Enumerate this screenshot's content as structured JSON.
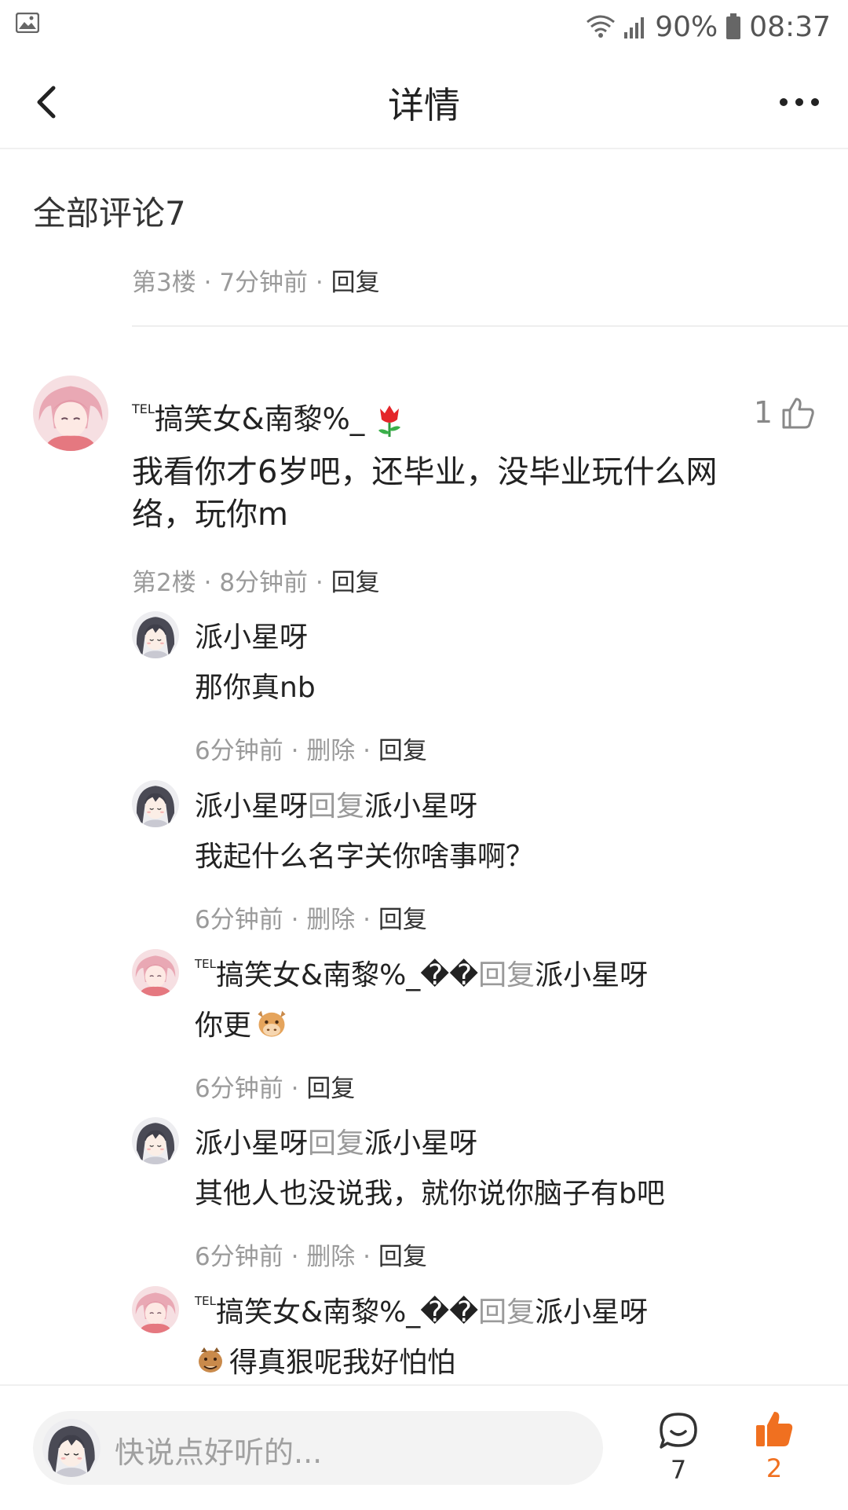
{
  "status_bar": {
    "battery": "90%",
    "time": "08:37"
  },
  "nav": {
    "title": "详情"
  },
  "comments_header": "全部评论7",
  "floor3_meta": {
    "floor": "第3楼",
    "time": "7分钟前",
    "reply": "回复",
    "sep": "·"
  },
  "main_comment": {
    "tel": "TEL",
    "user": "搞笑女&南黎%_",
    "likes": "1",
    "text": "我看你才6岁吧，还毕业，没毕业玩什么网络，玩你m",
    "floor": "第2楼",
    "time": "8分钟前",
    "reply": "回复"
  },
  "replies": [
    {
      "name": "派小星呀",
      "text": "那你真nb",
      "time": "6分钟前",
      "delete": "删除",
      "reply": "回复"
    },
    {
      "name": "派小星呀",
      "reply_kw": "回复",
      "target": "派小星呀",
      "text": "我起什么名字关你啥事啊？",
      "time": "6分钟前",
      "delete": "删除",
      "reply": "回复"
    },
    {
      "tel": "TEL",
      "name": "搞笑女&南黎%_��",
      "reply_kw": "回复",
      "target": "派小星呀",
      "text": "你更",
      "time": "6分钟前",
      "reply": "回复"
    },
    {
      "name": "派小星呀",
      "reply_kw": "回复",
      "target": "派小星呀",
      "text": "其他人也没说我，就你说你脑子有b吧",
      "time": "6分钟前",
      "delete": "删除",
      "reply": "回复"
    },
    {
      "tel": "TEL",
      "name": "搞笑女&南黎%_��",
      "reply_kw": "回复",
      "target": "派小星呀",
      "text": "得真狠呢我好怕怕"
    }
  ],
  "bottom": {
    "placeholder": "快说点好听的...",
    "comment_count": "7",
    "like_count": "2"
  },
  "colors": {
    "accent": "#f07020",
    "muted": "#9a9a9a"
  }
}
